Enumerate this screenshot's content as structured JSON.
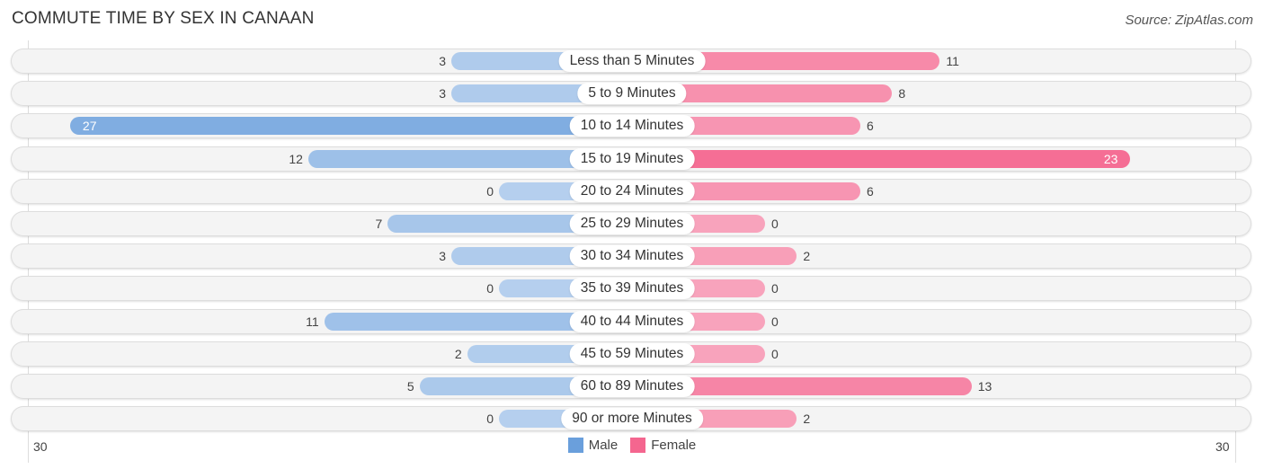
{
  "chart_data": {
    "type": "bar",
    "orientation": "horizontal-diverging",
    "title": "COMMUTE TIME BY SEX IN CANAAN",
    "source": "Source: ZipAtlas.com",
    "categories": [
      "Less than 5 Minutes",
      "5 to 9 Minutes",
      "10 to 14 Minutes",
      "15 to 19 Minutes",
      "20 to 24 Minutes",
      "25 to 29 Minutes",
      "30 to 34 Minutes",
      "35 to 39 Minutes",
      "40 to 44 Minutes",
      "45 to 59 Minutes",
      "60 to 89 Minutes",
      "90 or more Minutes"
    ],
    "series": [
      {
        "name": "Male",
        "color": "#6a9fdc",
        "values": [
          3,
          3,
          27,
          12,
          0,
          7,
          3,
          0,
          11,
          2,
          5,
          0
        ]
      },
      {
        "name": "Female",
        "color": "#f4668f",
        "values": [
          11,
          8,
          6,
          23,
          6,
          0,
          2,
          0,
          0,
          0,
          13,
          2
        ]
      }
    ],
    "axis": {
      "left_label": "30",
      "right_label": "30",
      "xlim": [
        -30,
        30
      ]
    },
    "legend": {
      "position": "bottom-center",
      "items": [
        "Male",
        "Female"
      ]
    }
  }
}
